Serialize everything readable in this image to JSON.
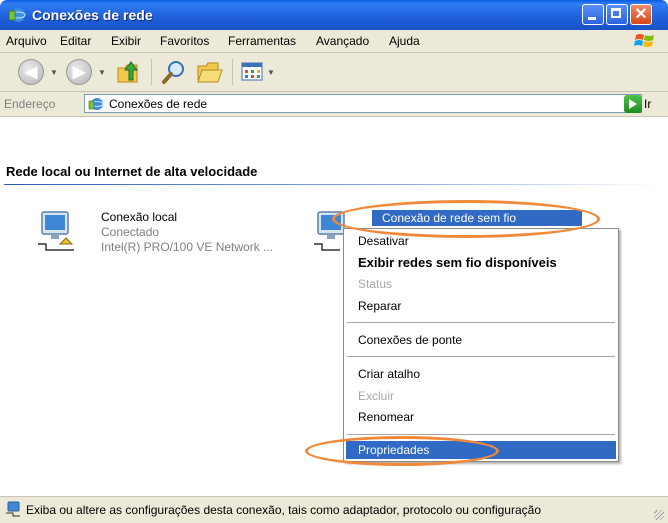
{
  "window": {
    "title": "Conexões de rede"
  },
  "menu": {
    "items": [
      "Arquivo",
      "Editar",
      "Exibir",
      "Favoritos",
      "Ferramentas",
      "Avançado",
      "Ajuda"
    ]
  },
  "toolbar": {
    "buttons": [
      "back-icon",
      "forward-icon",
      "up-folder-icon",
      "search-icon",
      "folders-icon",
      "views-icon"
    ]
  },
  "address": {
    "label": "Endereço",
    "value": "Conexões de rede",
    "go_label": "Ir"
  },
  "content": {
    "group_header": "Rede local ou Internet de alta velocidade",
    "connections": [
      {
        "name": "Conexão local",
        "status": "Conectado",
        "device": "Intel(R) PRO/100 VE Network ..."
      },
      {
        "name": "Conexão de rede sem fio"
      }
    ]
  },
  "context_menu": {
    "items": [
      {
        "label": "Desativar"
      },
      {
        "label": "Exibir redes sem fio disponíveis",
        "bold": true
      },
      {
        "label": "Status",
        "disabled": true
      },
      {
        "label": "Reparar"
      },
      {
        "label": "Conexões de ponte"
      },
      {
        "label": "Criar atalho"
      },
      {
        "label": "Excluir",
        "disabled": true
      },
      {
        "label": "Renomear"
      },
      {
        "label": "Propriedades",
        "highlighted": true
      }
    ]
  },
  "statusbar": {
    "text": "Exiba ou altere as configurações desta conexão, tais como adaptador, protocolo ou configuração"
  },
  "colors": {
    "titlebar": "#1f61dc",
    "selection": "#316ac5",
    "annotation": "#f08a3a",
    "chrome": "#ece9d8"
  }
}
